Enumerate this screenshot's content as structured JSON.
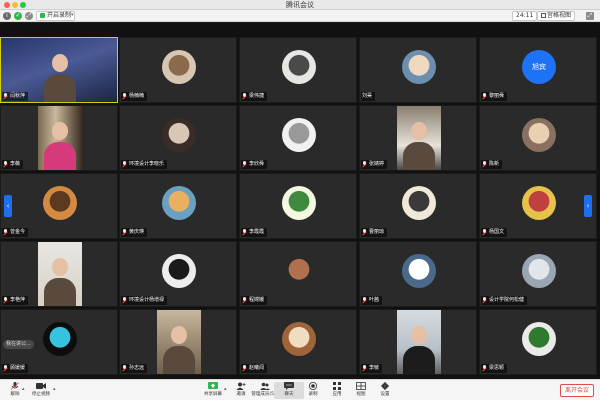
{
  "window": {
    "title": "腾讯会议"
  },
  "topbar": {
    "info_icon": "info-icon",
    "shield_icon": "shield-icon",
    "recording_label": "开启录制",
    "timer": "24:11",
    "view_label": "宫格视图"
  },
  "tiles": [
    {
      "name": "闫秋萍",
      "kind": "video",
      "active": true
    },
    {
      "name": "杨楠楠",
      "kind": "avatar",
      "bg": "#d7c6b2",
      "fg": "#8a6a4a"
    },
    {
      "name": "梁伟捷",
      "kind": "avatar",
      "bg": "#e8e6e2",
      "fg": "#4a4a4a"
    },
    {
      "name": "刘昊",
      "kind": "avatar",
      "bg": "#6c8fb0",
      "fg": "#f0d8c0",
      "nomic": true
    },
    {
      "name": "黎丽舜",
      "kind": "text",
      "text": "旭宾"
    },
    {
      "name": "李薇",
      "kind": "video2"
    },
    {
      "name": "环境设计李晓乐",
      "kind": "avatar",
      "bg": "#3a2c26",
      "fg": "#d9c7b5"
    },
    {
      "name": "李欣舜",
      "kind": "avatar",
      "bg": "#f1f1ef",
      "fg": "#9a9a9a"
    },
    {
      "name": "张婧婷",
      "kind": "video3"
    },
    {
      "name": "陈新",
      "kind": "avatar",
      "bg": "#8a7060",
      "fg": "#e8d0b0"
    },
    {
      "name": "曾金今",
      "kind": "avatar",
      "bg": "#d48a40",
      "fg": "#5b3a1f"
    },
    {
      "name": "黄庆瑛",
      "kind": "avatar",
      "bg": "#6aa0c0",
      "fg": "#e8b060"
    },
    {
      "name": "李霞霞",
      "kind": "avatar",
      "bg": "#f4f8e0",
      "fg": "#3f8a3f"
    },
    {
      "name": "曹丽琼",
      "kind": "avatar",
      "bg": "#f1e9d8",
      "fg": "#3a3a3a"
    },
    {
      "name": "杨国文",
      "kind": "avatar",
      "bg": "#e7c24a",
      "fg": "#c04040"
    },
    {
      "name": "李艳萍",
      "kind": "video4"
    },
    {
      "name": "环境设计杨增禄",
      "kind": "avatar",
      "bg": "#ededed",
      "fg": "#1a1a1a"
    },
    {
      "name": "程嫦娥",
      "kind": "avatar",
      "bg": "#2a2a2a",
      "fg": "#b07050"
    },
    {
      "name": "叶茜",
      "kind": "avatar",
      "bg": "#4a6a8a",
      "fg": "#ffffff"
    },
    {
      "name": "设计学院何松健",
      "kind": "avatar",
      "bg": "#9aa7b3",
      "fg": "#e0e6ea"
    },
    {
      "name": "顾媛媛",
      "kind": "avatar",
      "bg": "#0d0d0d",
      "fg": "#37c2e0"
    },
    {
      "name": "孙志远",
      "kind": "video5"
    },
    {
      "name": "赵曦闻",
      "kind": "avatar",
      "bg": "#a0643a",
      "fg": "#f0dcc0"
    },
    {
      "name": "李敏",
      "kind": "video6"
    },
    {
      "name": "梁思颖",
      "kind": "avatar",
      "bg": "#eaeaea",
      "fg": "#2f7a2f"
    }
  ],
  "speaking_hint": "我在讲公...",
  "toolbar": {
    "mute": "解除",
    "video": "停止视频",
    "share": "共享屏幕",
    "invite": "邀请",
    "members": "管理成员(57)",
    "chat": "聊天",
    "record": "录制",
    "apps": "应用",
    "view": "视图",
    "settings": "设置",
    "leave": "离开会议"
  }
}
